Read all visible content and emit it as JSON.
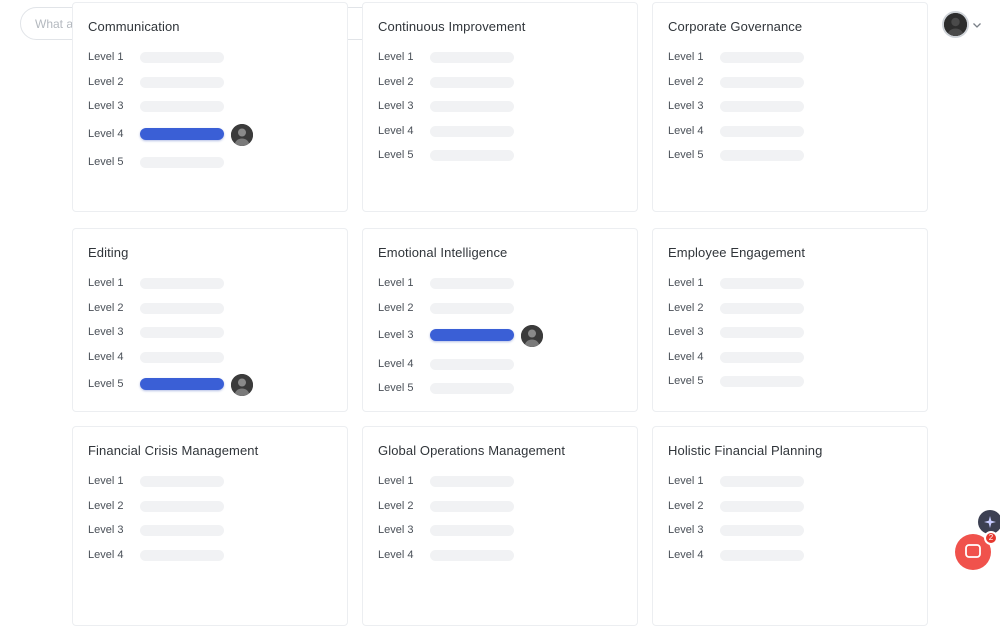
{
  "header": {
    "search_placeholder": "What are you looking for?",
    "icons": [
      "search-icon",
      "add-circle-icon",
      "chat-icon",
      "bell-icon",
      "user-avatar",
      "chevron-down-icon"
    ]
  },
  "cards": [
    {
      "title": "Communication",
      "levels": [
        "Level 1",
        "Level 2",
        "Level 3",
        "Level 4",
        "Level 5"
      ],
      "active_level": 4
    },
    {
      "title": "Continuous Improvement",
      "levels": [
        "Level 1",
        "Level 2",
        "Level 3",
        "Level 4",
        "Level 5"
      ],
      "active_level": null
    },
    {
      "title": "Corporate Governance",
      "levels": [
        "Level 1",
        "Level 2",
        "Level 3",
        "Level 4",
        "Level 5"
      ],
      "active_level": null
    },
    {
      "title": "Editing",
      "levels": [
        "Level 1",
        "Level 2",
        "Level 3",
        "Level 4",
        "Level 5"
      ],
      "active_level": 5
    },
    {
      "title": "Emotional Intelligence",
      "levels": [
        "Level 1",
        "Level 2",
        "Level 3",
        "Level 4",
        "Level 5"
      ],
      "active_level": 3
    },
    {
      "title": "Employee Engagement",
      "levels": [
        "Level 1",
        "Level 2",
        "Level 3",
        "Level 4",
        "Level 5"
      ],
      "active_level": null
    },
    {
      "title": "Financial Crisis Management",
      "levels": [
        "Level 1",
        "Level 2",
        "Level 3",
        "Level 4"
      ],
      "active_level": null
    },
    {
      "title": "Global Operations Management",
      "levels": [
        "Level 1",
        "Level 2",
        "Level 3",
        "Level 4"
      ],
      "active_level": null
    },
    {
      "title": "Holistic Financial Planning",
      "levels": [
        "Level 1",
        "Level 2",
        "Level 3",
        "Level 4"
      ],
      "active_level": null
    }
  ],
  "floating": {
    "badge_count": "2"
  },
  "colors": {
    "active_bar": "#3a5fd6",
    "inactive_bar": "#f1f2f4",
    "accent_dark": "#1f2a44"
  }
}
